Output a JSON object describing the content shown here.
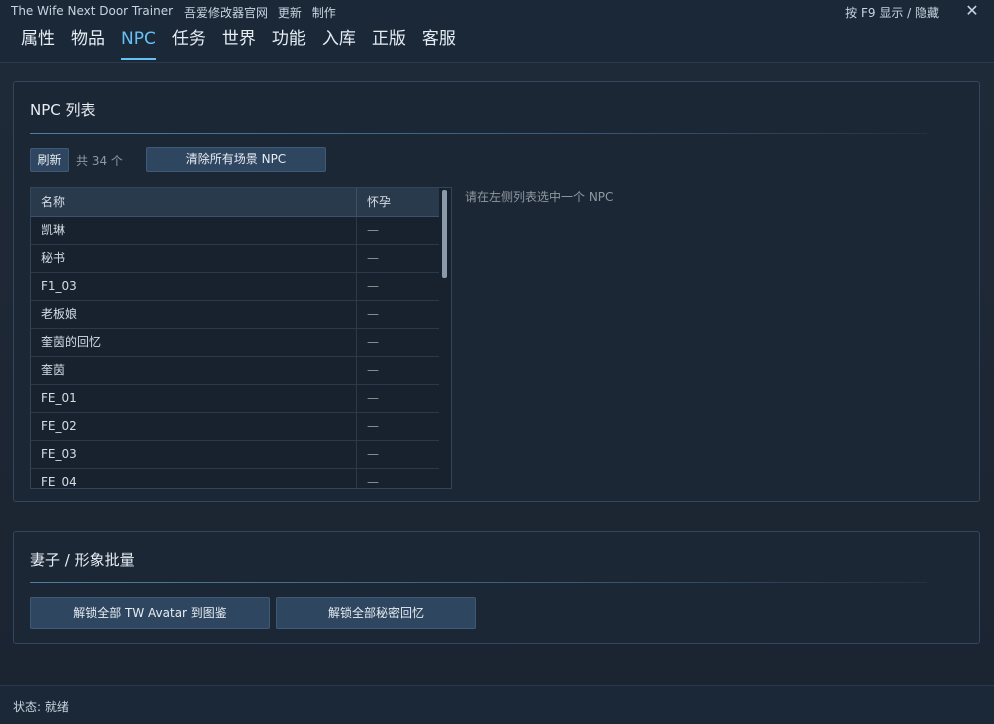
{
  "titlebar": {
    "app_title": "The Wife Next Door Trainer",
    "links": [
      "吾爱修改器官网",
      "更新",
      "制作"
    ],
    "hotkey_hint": "按 F9 显示 / 隐藏",
    "close_glyph": "✕"
  },
  "tabs": [
    {
      "label": "属性",
      "active": false
    },
    {
      "label": "物品",
      "active": false
    },
    {
      "label": "NPC",
      "active": true
    },
    {
      "label": "任务",
      "active": false
    },
    {
      "label": "世界",
      "active": false
    },
    {
      "label": "功能",
      "active": false
    },
    {
      "label": "入库",
      "active": false
    },
    {
      "label": "正版",
      "active": false
    },
    {
      "label": "客服",
      "active": false
    }
  ],
  "npc_panel": {
    "title": "NPC 列表",
    "refresh_label": "刷新",
    "count_text": "共 34 个",
    "clear_label": "清除所有场景 NPC",
    "table": {
      "headers": [
        "名称",
        "怀孕"
      ],
      "rows": [
        {
          "name": "凯琳",
          "pregnant": "—"
        },
        {
          "name": "秘书",
          "pregnant": "—"
        },
        {
          "name": "F1_03",
          "pregnant": "—"
        },
        {
          "name": "老板娘",
          "pregnant": "—"
        },
        {
          "name": "奎茵的回忆",
          "pregnant": "—"
        },
        {
          "name": "奎茵",
          "pregnant": "—"
        },
        {
          "name": "FE_01",
          "pregnant": "—"
        },
        {
          "name": "FE_02",
          "pregnant": "—"
        },
        {
          "name": "FE_03",
          "pregnant": "—"
        },
        {
          "name": "FE_04",
          "pregnant": "—"
        }
      ]
    },
    "detail_hint": "请在左侧列表选中一个 NPC"
  },
  "wife_panel": {
    "title": "妻子 / 形象批量",
    "unlock_avatar_label": "解锁全部 TW Avatar 到图鉴",
    "unlock_memory_label": "解锁全部秘密回忆"
  },
  "status": {
    "text": "状态: 就绪"
  },
  "colors": {
    "background": "#1b2838",
    "accent": "#66c0f4",
    "button": "#2f4660"
  }
}
